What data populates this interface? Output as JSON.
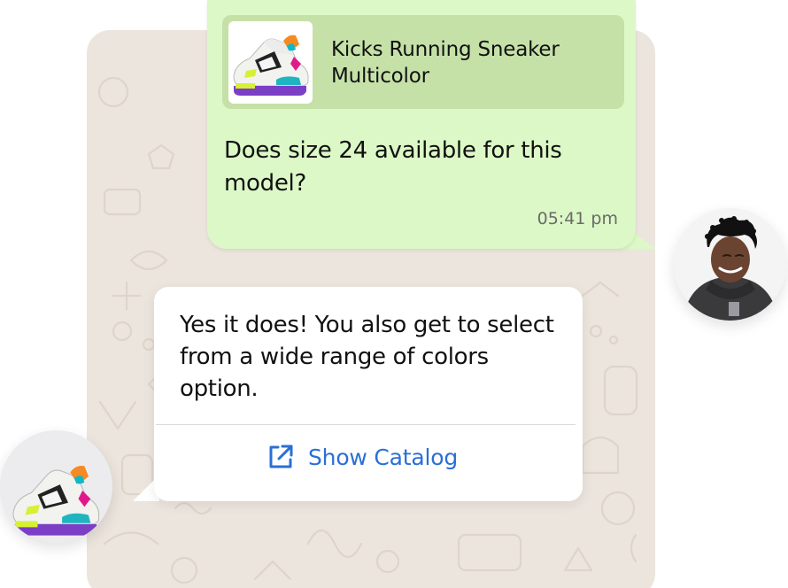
{
  "outgoing": {
    "product_title": "Kicks Running Sneaker Multicolor",
    "message": "Does size 24 available for this model?",
    "time": "05:41 pm"
  },
  "incoming": {
    "message": "Yes it does! You also get to select from a wide range of colors option.",
    "button_label": "Show Catalog",
    "button_icon": "external-link-icon"
  },
  "avatars": {
    "customer": "customer-avatar",
    "product": "sneaker-avatar"
  },
  "colors": {
    "outgoing_bubble": "#dcf8c6",
    "product_card": "#c5e1a8",
    "chat_background": "#ece5dd",
    "link": "#2a6fd6"
  }
}
